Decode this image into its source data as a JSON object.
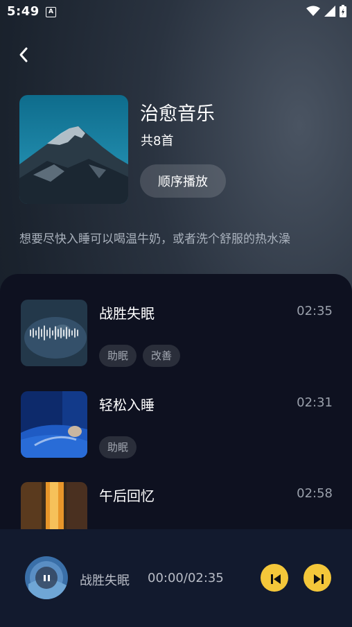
{
  "status": {
    "time": "5:49",
    "notif_letter": "A"
  },
  "album": {
    "title": "治愈音乐",
    "count": "共8首",
    "play_order": "顺序播放",
    "description": "想要尽快入睡可以喝温牛奶，或者洗个舒服的热水澡"
  },
  "tracks": [
    {
      "title": "战胜失眠",
      "duration": "02:35",
      "tags": [
        "助眠",
        "改善"
      ]
    },
    {
      "title": "轻松入睡",
      "duration": "02:31",
      "tags": [
        "助眠"
      ]
    },
    {
      "title": "午后回忆",
      "duration": "02:58",
      "tags": []
    }
  ],
  "player": {
    "title": "战胜失眠",
    "time": "00:00/02:35"
  },
  "colors": {
    "accent": "#f4c73a",
    "panel": "#0e1120",
    "player_bg": "#121a2e"
  }
}
